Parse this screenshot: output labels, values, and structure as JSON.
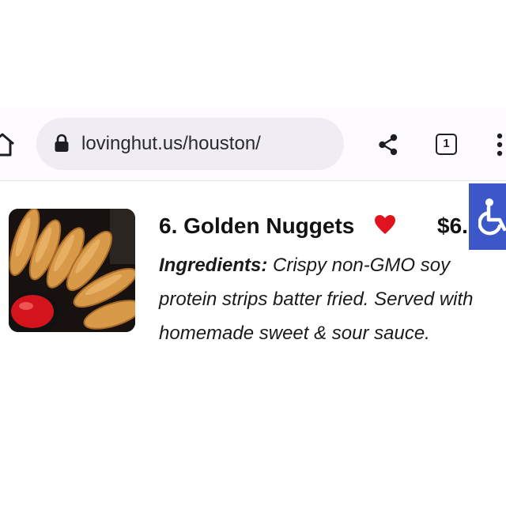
{
  "browser": {
    "url": "lovinghut.us/houston/",
    "tab_count": "1"
  },
  "menu_item": {
    "title": "6. Golden Nuggets",
    "price": "$6.",
    "ingredients_label": "Ingredients:",
    "ingredients_text": " Crispy non-GMO soy protein strips batter fried. Served with homemade sweet & sour sauce."
  },
  "icons": {
    "home": "home-icon",
    "lock": "lock-icon",
    "share": "share-icon",
    "tabs": "tabs-icon",
    "menu": "more-vert-icon",
    "favorite": "heart-icon",
    "accessibility": "wheelchair-icon"
  },
  "colors": {
    "heart": "#e0141f",
    "accessibility_button": "#3b57c8",
    "omnibox": "#efedf3"
  }
}
